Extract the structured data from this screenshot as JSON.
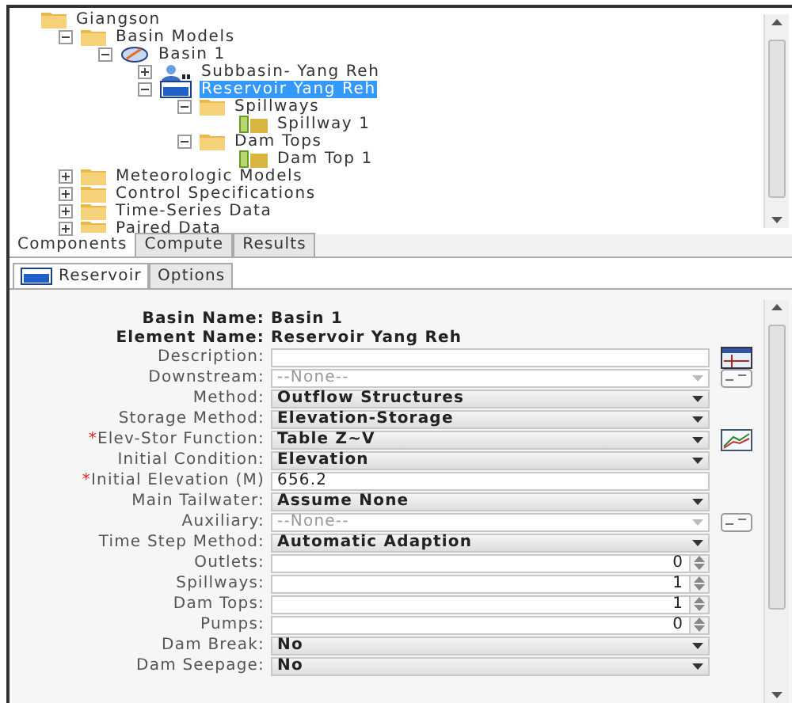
{
  "tree": [
    {
      "label": "Giangson",
      "kind": "folder",
      "selected": false,
      "children": [
        {
          "label": "Basin Models",
          "kind": "folder",
          "expanded": true,
          "selected": false,
          "children": [
            {
              "label": "Basin 1",
              "kind": "basin",
              "expanded": true,
              "selected": false,
              "children": [
                {
                  "label": "Subbasin- Yang Reh",
                  "kind": "subbasin",
                  "expanded": false,
                  "selected": false
                },
                {
                  "label": "Reservoir Yang Reh",
                  "kind": "reservoir",
                  "expanded": true,
                  "selected": true,
                  "children": [
                    {
                      "label": "Spillways",
                      "kind": "folder",
                      "expanded": true,
                      "selected": false,
                      "children": [
                        {
                          "label": "Spillway 1",
                          "kind": "element",
                          "selected": false
                        }
                      ]
                    },
                    {
                      "label": "Dam Tops",
                      "kind": "folder",
                      "expanded": true,
                      "selected": false,
                      "children": [
                        {
                          "label": "Dam Top 1",
                          "kind": "element",
                          "selected": false
                        }
                      ]
                    }
                  ]
                }
              ]
            }
          ]
        },
        {
          "label": "Meteorologic Models",
          "kind": "folder",
          "expanded": false,
          "selected": false
        },
        {
          "label": "Control Specifications",
          "kind": "folder",
          "expanded": false,
          "selected": false
        },
        {
          "label": "Time-Series Data",
          "kind": "folder",
          "expanded": false,
          "selected": false
        },
        {
          "label": "Paired Data",
          "kind": "folder",
          "expanded": false,
          "selected": false
        }
      ]
    }
  ],
  "tabs": [
    {
      "label": "Components",
      "selected": true
    },
    {
      "label": "Compute",
      "selected": false
    },
    {
      "label": "Results",
      "selected": false
    }
  ],
  "editor_tabs": [
    {
      "label": "Reservoir",
      "selected": true
    },
    {
      "label": "Options",
      "selected": false
    }
  ],
  "fields": [
    {
      "kind": "header",
      "label": "Basin Name:",
      "value": "Basin 1"
    },
    {
      "kind": "header",
      "label": "Element Name:",
      "value": "Reservoir Yang Reh"
    },
    {
      "kind": "text",
      "label": "Description:",
      "tool": {
        "kind": "table"
      }
    },
    {
      "kind": "combo",
      "label": "Downstream:",
      "value": "--None--",
      "disabled": true,
      "tool": {
        "kind": "small"
      }
    },
    {
      "kind": "combo",
      "label": "Method:",
      "value": "Outflow Structures",
      "disabled": false
    },
    {
      "kind": "combo",
      "label": "Storage Method:",
      "value": "Elevation-Storage",
      "disabled": false
    },
    {
      "kind": "combo",
      "marker": "*",
      "label": "Elev-Stor Function:",
      "value": "Table Z~V",
      "disabled": false,
      "tool": {
        "kind": "chart"
      }
    },
    {
      "kind": "combo",
      "label": "Initial Condition:",
      "value": "Elevation",
      "disabled": false
    },
    {
      "kind": "text",
      "marker": "*",
      "label": "Initial Elevation (M)",
      "value": "656.2"
    },
    {
      "kind": "combo",
      "label": "Main Tailwater:",
      "value": "Assume None",
      "disabled": false
    },
    {
      "kind": "combo",
      "label": "Auxiliary:",
      "value": "--None--",
      "disabled": true,
      "tool": {
        "kind": "small"
      }
    },
    {
      "kind": "combo",
      "label": "Time Step Method:",
      "value": "Automatic Adaption",
      "disabled": false
    },
    {
      "kind": "spinner",
      "label": "Outlets:",
      "value": "0"
    },
    {
      "kind": "spinner",
      "label": "Spillways:",
      "value": "1"
    },
    {
      "kind": "spinner",
      "label": "Dam Tops:",
      "value": "1"
    },
    {
      "kind": "spinner",
      "label": "Pumps:",
      "value": "0"
    },
    {
      "kind": "combo",
      "label": "Dam Break:",
      "value": "No",
      "disabled": false
    },
    {
      "kind": "combo",
      "label": "Dam Seepage:",
      "value": "No",
      "disabled": false
    }
  ]
}
